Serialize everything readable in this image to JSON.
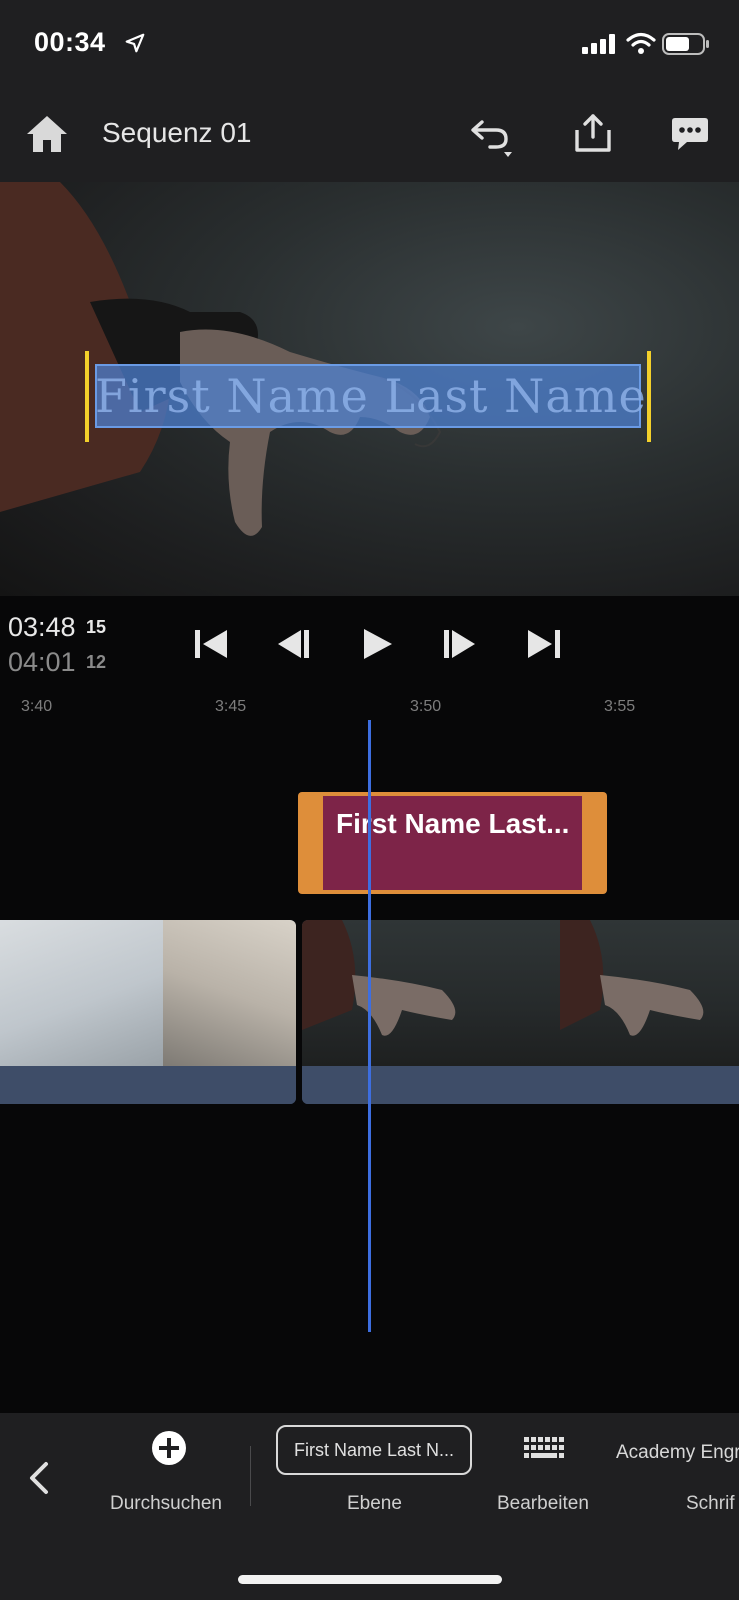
{
  "status_bar": {
    "time": "00:34",
    "icons": [
      "location-arrow-icon",
      "cellular-signal-icon",
      "wifi-icon",
      "battery-icon"
    ]
  },
  "header": {
    "title": "Sequenz 01",
    "icons": [
      "home-icon",
      "undo-icon",
      "share-icon",
      "comments-icon"
    ]
  },
  "preview": {
    "title_overlay_text": "First Name Last Name"
  },
  "transport": {
    "current_time": "03:48",
    "current_frames": "15",
    "duration_time": "04:01",
    "duration_frames": "12",
    "buttons": [
      "skip-to-start",
      "step-back",
      "play",
      "step-forward",
      "skip-to-end"
    ]
  },
  "ruler": {
    "ticks": [
      "3:40",
      "3:45",
      "3:50",
      "3:55"
    ]
  },
  "timeline": {
    "title_clip_label": "First Name Last..."
  },
  "toolbar": {
    "browse_label": "Durchsuchen",
    "layer_pill_text": "First Name Last N...",
    "layer_label": "Ebene",
    "edit_label": "Bearbeiten",
    "font_name": "Academy Engr",
    "font_label": "Schrif"
  },
  "colors": {
    "accent_playhead": "#3d6ee0",
    "title_clip_border": "#de8e3a",
    "title_clip_fill": "#7d2448",
    "trim_handles": "#f3d02b"
  }
}
